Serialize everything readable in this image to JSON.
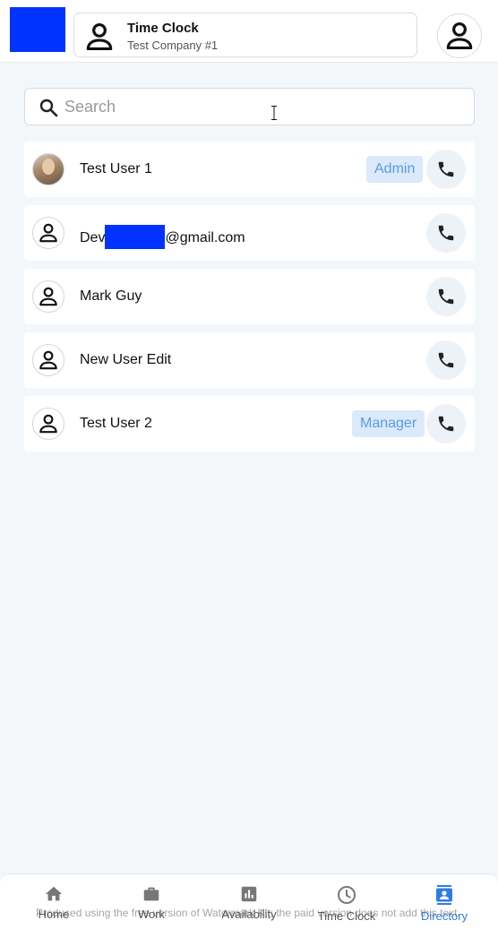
{
  "header": {
    "title": "Time Clock",
    "company": "Test Company #1"
  },
  "search": {
    "placeholder": "Search",
    "value": ""
  },
  "users": [
    {
      "name": "Test User 1",
      "role": "Admin",
      "avatar": "photo"
    },
    {
      "name_prefix": "Dev",
      "name_suffix": "@gmail.com",
      "role": "",
      "avatar": "person-icon"
    },
    {
      "name": "Mark Guy",
      "role": "",
      "avatar": "person-icon"
    },
    {
      "name": "New User Edit",
      "role": "",
      "avatar": "person-icon"
    },
    {
      "name": "Test User 2",
      "role": "Manager",
      "avatar": "person-icon"
    }
  ],
  "nav": [
    {
      "label": "Home",
      "icon": "home-icon"
    },
    {
      "label": "Work",
      "icon": "briefcase-icon"
    },
    {
      "label": "Availability",
      "icon": "bar-chart-icon"
    },
    {
      "label": "Time Clock",
      "icon": "clock-icon"
    },
    {
      "label": "Directory",
      "icon": "contacts-icon",
      "active": true
    }
  ],
  "watermark": "Produced using the free version of Watermark Kit; the paid version does not add this text.",
  "colors": {
    "accent": "#2f7de1",
    "badge_bg": "#dbe9fb",
    "badge_text": "#5b9be8",
    "redaction": "#0033ff"
  }
}
